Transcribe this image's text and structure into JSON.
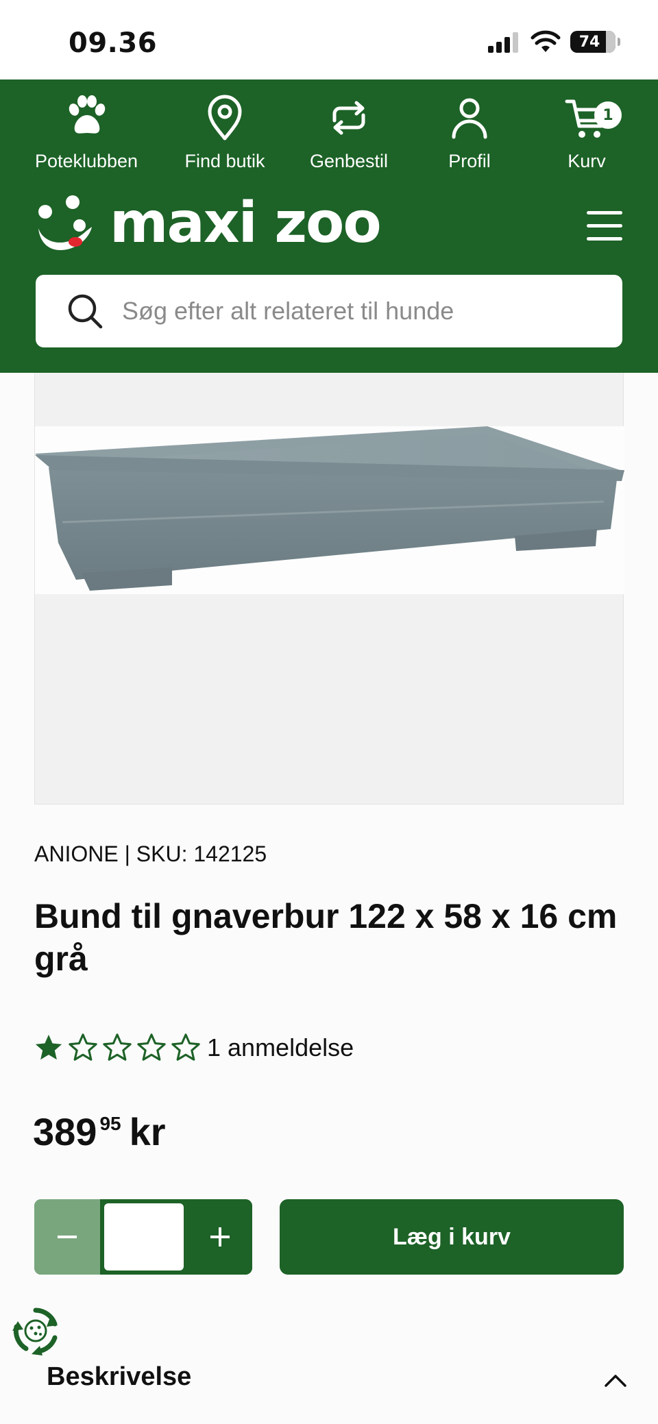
{
  "status_bar": {
    "time": "09.36",
    "battery": "74"
  },
  "header": {
    "nav": [
      {
        "label": "Poteklubben",
        "icon": "paw-icon"
      },
      {
        "label": "Find butik",
        "icon": "location-pin-icon"
      },
      {
        "label": "Genbestil",
        "icon": "reorder-icon"
      },
      {
        "label": "Profil",
        "icon": "user-icon"
      },
      {
        "label": "Kurv",
        "icon": "cart-icon",
        "badge": "1"
      }
    ],
    "logo_text": "maxi zoo",
    "search_placeholder": "Søg efter alt relateret til hunde"
  },
  "product": {
    "brand_sku": "ANIONE | SKU: 142125",
    "title": "Bund til gnaverbur 122 x 58 x 16 cm grå",
    "rating": 1,
    "rating_max": 5,
    "review_count": "1 anmeldelse",
    "price_main": "389",
    "price_decimals": "95",
    "price_currency": "kr",
    "quantity_value": "",
    "add_to_cart_label": "Læg i kurv"
  },
  "sections": {
    "description_label": "Beskrivelse"
  },
  "colors": {
    "brand_green": "#1d6227",
    "light_green": "#7aa67e",
    "logo_red": "#e3262e"
  }
}
